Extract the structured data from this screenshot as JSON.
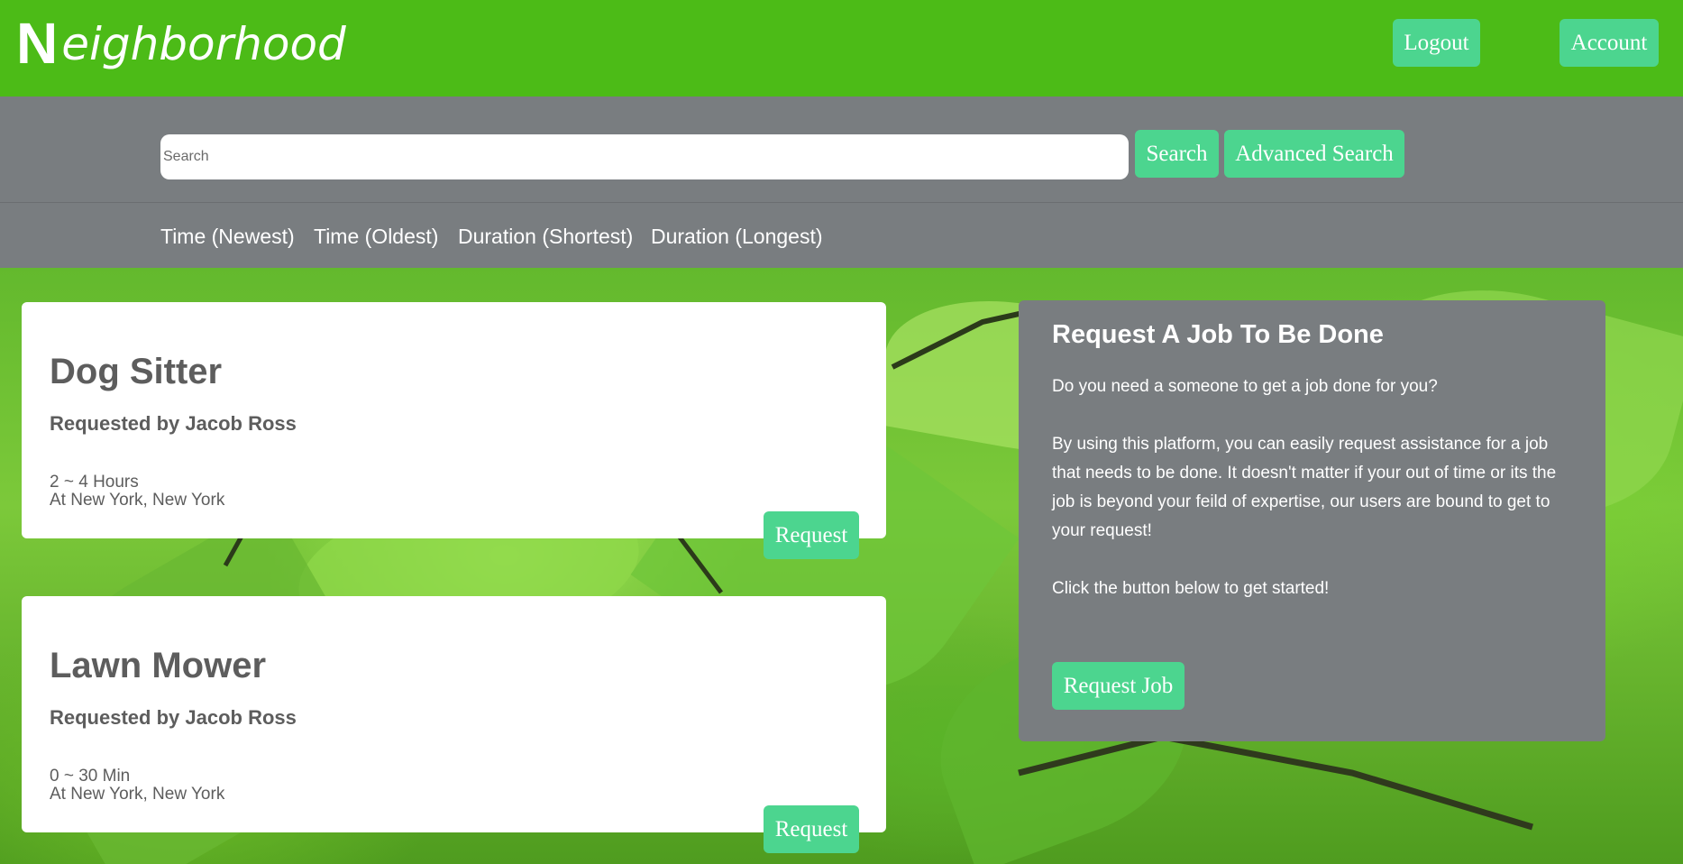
{
  "header": {
    "logo_mark": "N",
    "logo_rest": "eighborhood",
    "logout_label": "Logout",
    "account_label": "Account"
  },
  "search": {
    "placeholder": "Search",
    "search_label": "Search",
    "advanced_label": "Advanced Search"
  },
  "sort": {
    "options": [
      "Time (Newest)",
      "Time (Oldest)",
      "Duration (Shortest)",
      "Duration (Longest)"
    ]
  },
  "jobs": [
    {
      "title": "Dog Sitter",
      "requested_by": "Requested by Jacob Ross",
      "duration": "2 ~ 4 Hours",
      "location": "At New York, New York",
      "button_label": "Request"
    },
    {
      "title": "Lawn Mower",
      "requested_by": "Requested by Jacob Ross",
      "duration": "0 ~ 30 Min",
      "location": "At New York, New York",
      "button_label": "Request"
    }
  ],
  "panel": {
    "title": "Request A Job To Be Done",
    "intro": "Do you need a someone to get a job done for you?",
    "body": "By using this platform, you can easily request assistance for a job that needs to be done. It doesn't matter if your out of time or its the job is beyond your feild of expertise, our users are bound to get to your request!",
    "cta_text": "Click the button below to get started!",
    "button_label": "Request Job"
  },
  "colors": {
    "brand_green": "#4cbb17",
    "button_green": "#4cd58f",
    "gray_bar": "#797d80"
  }
}
